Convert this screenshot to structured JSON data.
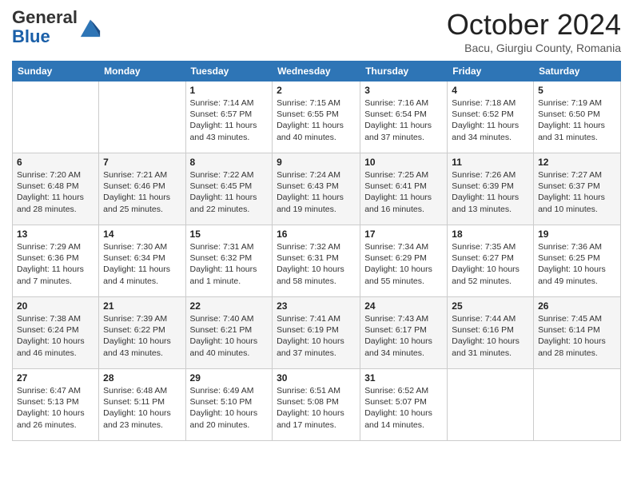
{
  "header": {
    "logo_line1": "General",
    "logo_line2": "Blue",
    "month": "October 2024",
    "location": "Bacu, Giurgiu County, Romania"
  },
  "days_of_week": [
    "Sunday",
    "Monday",
    "Tuesday",
    "Wednesday",
    "Thursday",
    "Friday",
    "Saturday"
  ],
  "weeks": [
    [
      {
        "day": "",
        "info": ""
      },
      {
        "day": "",
        "info": ""
      },
      {
        "day": "1",
        "info": "Sunrise: 7:14 AM\nSunset: 6:57 PM\nDaylight: 11 hours and 43 minutes."
      },
      {
        "day": "2",
        "info": "Sunrise: 7:15 AM\nSunset: 6:55 PM\nDaylight: 11 hours and 40 minutes."
      },
      {
        "day": "3",
        "info": "Sunrise: 7:16 AM\nSunset: 6:54 PM\nDaylight: 11 hours and 37 minutes."
      },
      {
        "day": "4",
        "info": "Sunrise: 7:18 AM\nSunset: 6:52 PM\nDaylight: 11 hours and 34 minutes."
      },
      {
        "day": "5",
        "info": "Sunrise: 7:19 AM\nSunset: 6:50 PM\nDaylight: 11 hours and 31 minutes."
      }
    ],
    [
      {
        "day": "6",
        "info": "Sunrise: 7:20 AM\nSunset: 6:48 PM\nDaylight: 11 hours and 28 minutes."
      },
      {
        "day": "7",
        "info": "Sunrise: 7:21 AM\nSunset: 6:46 PM\nDaylight: 11 hours and 25 minutes."
      },
      {
        "day": "8",
        "info": "Sunrise: 7:22 AM\nSunset: 6:45 PM\nDaylight: 11 hours and 22 minutes."
      },
      {
        "day": "9",
        "info": "Sunrise: 7:24 AM\nSunset: 6:43 PM\nDaylight: 11 hours and 19 minutes."
      },
      {
        "day": "10",
        "info": "Sunrise: 7:25 AM\nSunset: 6:41 PM\nDaylight: 11 hours and 16 minutes."
      },
      {
        "day": "11",
        "info": "Sunrise: 7:26 AM\nSunset: 6:39 PM\nDaylight: 11 hours and 13 minutes."
      },
      {
        "day": "12",
        "info": "Sunrise: 7:27 AM\nSunset: 6:37 PM\nDaylight: 11 hours and 10 minutes."
      }
    ],
    [
      {
        "day": "13",
        "info": "Sunrise: 7:29 AM\nSunset: 6:36 PM\nDaylight: 11 hours and 7 minutes."
      },
      {
        "day": "14",
        "info": "Sunrise: 7:30 AM\nSunset: 6:34 PM\nDaylight: 11 hours and 4 minutes."
      },
      {
        "day": "15",
        "info": "Sunrise: 7:31 AM\nSunset: 6:32 PM\nDaylight: 11 hours and 1 minute."
      },
      {
        "day": "16",
        "info": "Sunrise: 7:32 AM\nSunset: 6:31 PM\nDaylight: 10 hours and 58 minutes."
      },
      {
        "day": "17",
        "info": "Sunrise: 7:34 AM\nSunset: 6:29 PM\nDaylight: 10 hours and 55 minutes."
      },
      {
        "day": "18",
        "info": "Sunrise: 7:35 AM\nSunset: 6:27 PM\nDaylight: 10 hours and 52 minutes."
      },
      {
        "day": "19",
        "info": "Sunrise: 7:36 AM\nSunset: 6:25 PM\nDaylight: 10 hours and 49 minutes."
      }
    ],
    [
      {
        "day": "20",
        "info": "Sunrise: 7:38 AM\nSunset: 6:24 PM\nDaylight: 10 hours and 46 minutes."
      },
      {
        "day": "21",
        "info": "Sunrise: 7:39 AM\nSunset: 6:22 PM\nDaylight: 10 hours and 43 minutes."
      },
      {
        "day": "22",
        "info": "Sunrise: 7:40 AM\nSunset: 6:21 PM\nDaylight: 10 hours and 40 minutes."
      },
      {
        "day": "23",
        "info": "Sunrise: 7:41 AM\nSunset: 6:19 PM\nDaylight: 10 hours and 37 minutes."
      },
      {
        "day": "24",
        "info": "Sunrise: 7:43 AM\nSunset: 6:17 PM\nDaylight: 10 hours and 34 minutes."
      },
      {
        "day": "25",
        "info": "Sunrise: 7:44 AM\nSunset: 6:16 PM\nDaylight: 10 hours and 31 minutes."
      },
      {
        "day": "26",
        "info": "Sunrise: 7:45 AM\nSunset: 6:14 PM\nDaylight: 10 hours and 28 minutes."
      }
    ],
    [
      {
        "day": "27",
        "info": "Sunrise: 6:47 AM\nSunset: 5:13 PM\nDaylight: 10 hours and 26 minutes."
      },
      {
        "day": "28",
        "info": "Sunrise: 6:48 AM\nSunset: 5:11 PM\nDaylight: 10 hours and 23 minutes."
      },
      {
        "day": "29",
        "info": "Sunrise: 6:49 AM\nSunset: 5:10 PM\nDaylight: 10 hours and 20 minutes."
      },
      {
        "day": "30",
        "info": "Sunrise: 6:51 AM\nSunset: 5:08 PM\nDaylight: 10 hours and 17 minutes."
      },
      {
        "day": "31",
        "info": "Sunrise: 6:52 AM\nSunset: 5:07 PM\nDaylight: 10 hours and 14 minutes."
      },
      {
        "day": "",
        "info": ""
      },
      {
        "day": "",
        "info": ""
      }
    ]
  ]
}
